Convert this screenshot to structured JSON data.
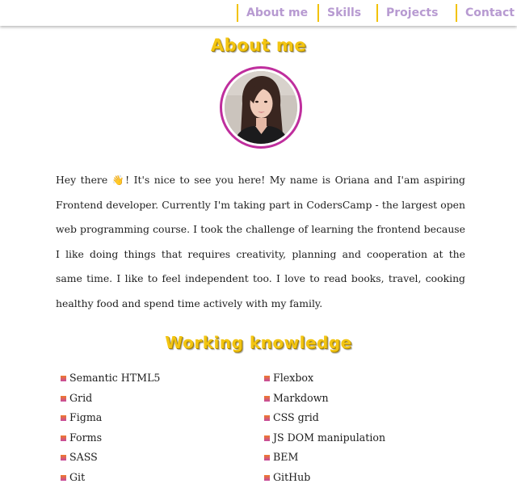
{
  "nav": {
    "items": [
      {
        "label": "About me"
      },
      {
        "label": "Skills"
      },
      {
        "label": "Projects"
      },
      {
        "label": "Contact"
      }
    ]
  },
  "about": {
    "title": "About me",
    "text_before_emoji": "Hey there ",
    "emoji": "👋",
    "text_after_emoji": "! It's nice to see you here! My name is Oriana and I'am aspiring Frontend developer. Currently I'm taking part in CodersCamp - the largest open web programming course. I took the challenge of learning the frontend because I like doing things that requires creativity, planning and cooperation at the same time. I like to feel independent too. I love to read books, travel, cooking healthy food and spend time actively with my family."
  },
  "skills": {
    "title": "Working knowledge",
    "left": [
      "Semantic HTML5",
      "Grid",
      "Figma",
      "Forms",
      "SASS",
      "Git"
    ],
    "right": [
      "Flexbox",
      "Markdown",
      "CSS grid",
      "JS DOM manipulation",
      "BEM",
      "GitHub"
    ]
  },
  "colors": {
    "accent_yellow": "#f3c512",
    "nav_text": "#b79ad1",
    "avatar_border": "#bf2e9d"
  }
}
